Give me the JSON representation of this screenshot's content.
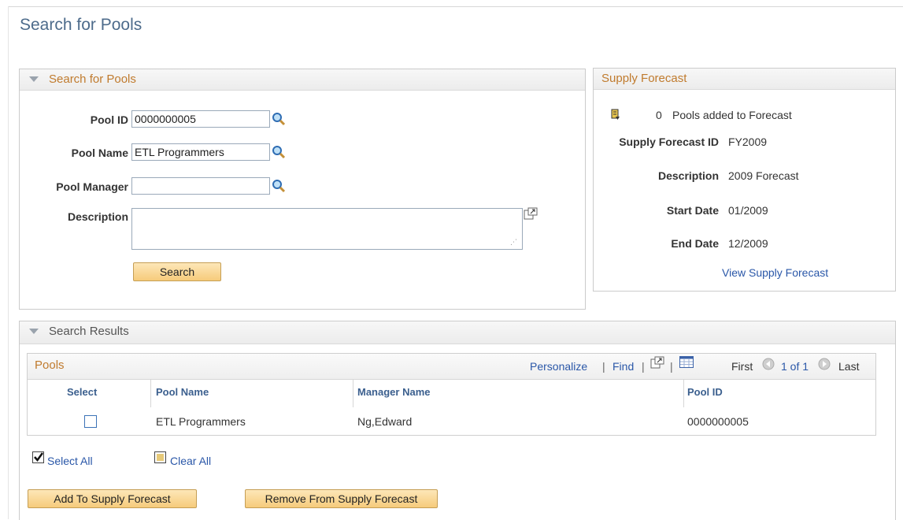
{
  "page": {
    "title": "Search for Pools"
  },
  "search_group": {
    "title": "Search for Pools",
    "pool_id_label": "Pool ID",
    "pool_id_value": "0000000005",
    "pool_name_label": "Pool Name",
    "pool_name_value": "ETL Programmers",
    "pool_manager_label": "Pool Manager",
    "pool_manager_value": "",
    "description_label": "Description",
    "description_value": "",
    "search_button": "Search"
  },
  "supply_forecast": {
    "title": "Supply Forecast",
    "pools_added_count": "0",
    "pools_added_text": "Pools added to Forecast",
    "forecast_id_label": "Supply Forecast ID",
    "forecast_id_value": "FY2009",
    "description_label": "Description",
    "description_value": "2009 Forecast",
    "start_date_label": "Start Date",
    "start_date_value": "01/2009",
    "end_date_label": "End Date",
    "end_date_value": "12/2009",
    "view_link": "View Supply Forecast"
  },
  "results": {
    "title": "Search Results",
    "grid_title": "Pools",
    "personalize": "Personalize",
    "find": "Find",
    "first": "First",
    "page_indicator": "1 of 1",
    "last": "Last",
    "columns": [
      "Select",
      "Pool Name",
      "Manager Name",
      "Pool ID"
    ],
    "rows": [
      {
        "selected": false,
        "pool_name": "ETL Programmers",
        "manager_name": "Ng,Edward",
        "pool_id": "0000000005"
      }
    ],
    "select_all": "Select All",
    "clear_all": "Clear All",
    "add_button": "Add To Supply Forecast",
    "remove_button": "Remove From Supply Forecast"
  },
  "colors": {
    "title": "#4d6b8b",
    "group_title": "#c07b2e",
    "link": "#2a57a8",
    "button": "#f6cb7b"
  },
  "icons": [
    "lookup-icon",
    "expand-icon",
    "collapse-triangle-icon",
    "forecast-icon",
    "grid-icon",
    "arrow-left-icon",
    "arrow-right-icon",
    "checkbox-icon"
  ]
}
